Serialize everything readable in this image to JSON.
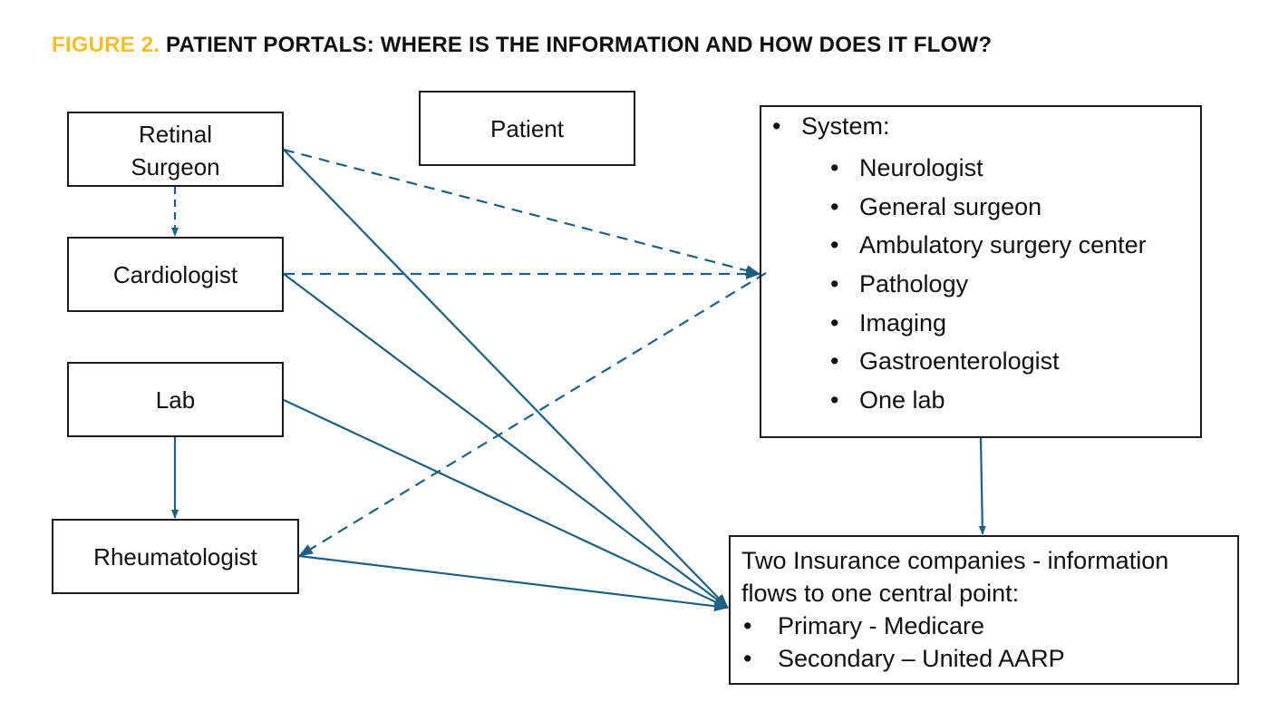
{
  "title": {
    "figure_label": "FIGURE 2.",
    "text": "PATIENT PORTALS: WHERE IS THE INFORMATION AND HOW DOES IT FLOW?"
  },
  "colors": {
    "figure_label": "#f2bf2c",
    "connector": "#1f5f80",
    "box_border": "#1b1b1b"
  },
  "nodes": {
    "retinal_surgeon": "Retinal Surgeon",
    "patient": "Patient",
    "cardiologist": "Cardiologist",
    "lab": "Lab",
    "rheumatologist": "Rheumatologist",
    "system": {
      "heading": "System:",
      "items": [
        "Neurologist",
        "General surgeon",
        "Ambulatory surgery center",
        "Pathology",
        "Imaging",
        "Gastroenterologist",
        "One lab"
      ]
    },
    "insurance": {
      "heading": "Two Insurance companies - information flows to one central point:",
      "items": [
        "Primary - Medicare",
        "Secondary – United AARP"
      ]
    }
  },
  "edges": [
    {
      "from": "retinal_surgeon",
      "to": "cardiologist",
      "style": "dashed"
    },
    {
      "from": "retinal_surgeon",
      "to": "system",
      "style": "dashed"
    },
    {
      "from": "cardiologist",
      "to": "system",
      "style": "dashed"
    },
    {
      "from": "system",
      "to": "rheumatologist",
      "style": "dashed"
    },
    {
      "from": "retinal_surgeon",
      "to": "insurance",
      "style": "solid"
    },
    {
      "from": "cardiologist",
      "to": "insurance",
      "style": "solid"
    },
    {
      "from": "lab",
      "to": "insurance",
      "style": "solid"
    },
    {
      "from": "rheumatologist",
      "to": "insurance",
      "style": "solid"
    },
    {
      "from": "lab",
      "to": "rheumatologist",
      "style": "solid"
    },
    {
      "from": "system",
      "to": "insurance",
      "style": "solid"
    }
  ]
}
